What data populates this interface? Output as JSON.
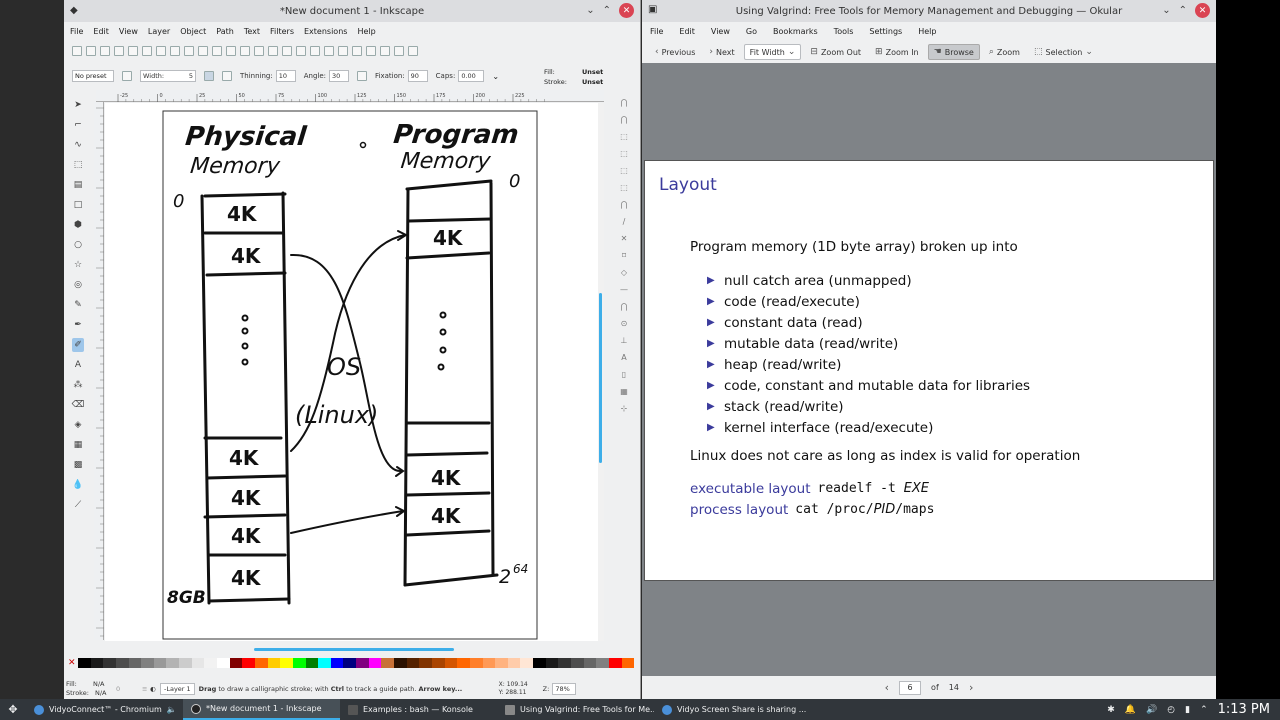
{
  "inkscape": {
    "title": "*New document 1 - Inkscape",
    "menu": [
      "File",
      "Edit",
      "View",
      "Layer",
      "Object",
      "Path",
      "Text",
      "Filters",
      "Extensions",
      "Help"
    ],
    "tool_controls": {
      "preset": "No preset",
      "width_label": "Width:",
      "width_value": "5",
      "thinning_label": "Thinning:",
      "thinning_value": "10",
      "angle_label": "Angle:",
      "angle_value": "30",
      "fixation_label": "Fixation:",
      "fixation_value": "90",
      "caps_label": "Caps:",
      "caps_value": "0.00",
      "fill_label": "Fill:",
      "fill_value": "Unset",
      "stroke_label": "Stroke:",
      "stroke_value": "Unset"
    },
    "ruler_ticks": [
      "-25",
      "0",
      "25",
      "50",
      "75",
      "100",
      "125",
      "150",
      "175",
      "200",
      "225"
    ],
    "drawing": {
      "heading_left_1": "Physical",
      "heading_left_2": "Memory",
      "heading_right_1": "Program",
      "heading_right_2": "Memory",
      "zero_left": "0",
      "zero_right": "0",
      "block": "4K",
      "os_1": "OS",
      "os_2": "(Linux)",
      "size_left": "8GB",
      "size_right": "2",
      "size_right_exp": "64"
    },
    "status": {
      "fill_label": "Fill:",
      "fill_value": "N/A",
      "stroke_label": "Stroke:",
      "stroke_value": "N/A",
      "opacity": "0",
      "layer": "-Layer 1",
      "hint_bold_1": "Drag",
      "hint_1": " to draw a calligraphic stroke; with ",
      "hint_bold_2": "Ctrl",
      "hint_2": " to track a guide path. ",
      "hint_bold_3": "Arrow key...",
      "x_label": "X:",
      "x_value": "109.14",
      "y_label": "Y:",
      "y_value": "288.11",
      "z_label": "Z:",
      "zoom": "78%"
    }
  },
  "okular": {
    "title": "Using Valgrind: Free Tools for Memory Management and Debugging — Okular",
    "menu": [
      "File",
      "Edit",
      "View",
      "Go",
      "Bookmarks",
      "Tools",
      "Settings",
      "Help"
    ],
    "toolbar": {
      "previous": "Previous",
      "next": "Next",
      "fit": "Fit Width",
      "zoom_out": "Zoom Out",
      "zoom_in": "Zoom In",
      "browse": "Browse",
      "zoom": "Zoom",
      "selection": "Selection"
    },
    "slide": {
      "title": "Layout",
      "intro": "Program memory (1D byte array) broken up into",
      "items": [
        "null catch area (unmapped)",
        "code (read/execute)",
        "constant data (read)",
        "mutable data (read/write)",
        "heap (read/write)",
        "code, constant and mutable data for libraries",
        "stack (read/write)",
        "kernel interface (read/execute)"
      ],
      "note": "Linux does not care as long as index is valid for operation",
      "exec_label": "executable layout",
      "exec_cmd": "readelf -t ",
      "exec_arg": "EXE",
      "proc_label": "process layout",
      "proc_cmd_1": "cat /proc/",
      "proc_arg": "PID",
      "proc_cmd_2": "/maps"
    },
    "page": "6",
    "of_label": "of",
    "total_pages": "14"
  },
  "taskbar": {
    "tasks": [
      "VidyoConnect™ - Chromium",
      "*New document 1 - Inkscape",
      "Examples : bash — Konsole",
      "Using Valgrind: Free Tools for Me...",
      "Vidyo Screen Share is sharing ..."
    ],
    "clock": "1:13 PM"
  },
  "colors": {
    "accent": "#3daee9",
    "slide_accent": "#3b3b9c",
    "close": "#da4453",
    "taskbar": "#31363b"
  },
  "palette": [
    "#000000",
    "#1a1a1a",
    "#333333",
    "#4d4d4d",
    "#666666",
    "#808080",
    "#999999",
    "#b3b3b3",
    "#cccccc",
    "#e6e6e6",
    "#f2f2f2",
    "#ffffff",
    "#800000",
    "#ff0000",
    "#ff6600",
    "#ffcc00",
    "#ffff00",
    "#00ff00",
    "#008000",
    "#00ffff",
    "#0000ff",
    "#000080",
    "#800080",
    "#ff00ff",
    "#c87137",
    "#2b1100",
    "#552200",
    "#803300",
    "#aa4400",
    "#d45500",
    "#ff6600",
    "#ff7f2a",
    "#ff9955",
    "#ffb380",
    "#ffccaa",
    "#ffe6d5",
    "#000000",
    "#1a1a1a",
    "#333333",
    "#4d4d4d",
    "#666666",
    "#808080",
    "#ff0000",
    "#ff6600"
  ]
}
